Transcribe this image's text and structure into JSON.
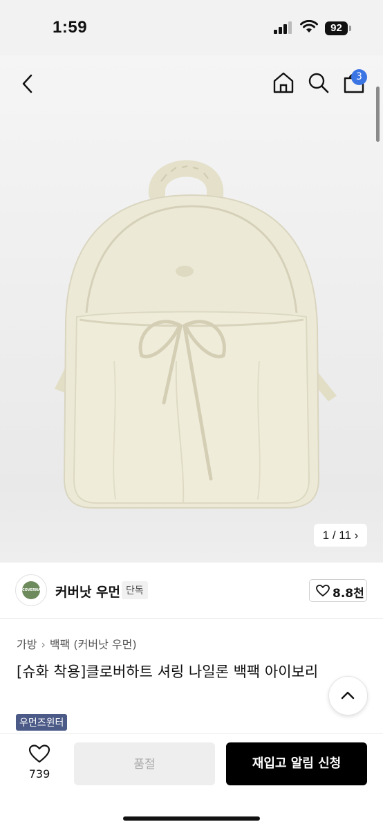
{
  "status_bar": {
    "time": "1:59",
    "battery": "92"
  },
  "header": {
    "icons": [
      "chevron-left-icon",
      "home-icon",
      "search-icon",
      "bag-icon"
    ],
    "cart_count": "3"
  },
  "gallery": {
    "counter": "1 / 11",
    "counter_icon": "chevron-right-icon"
  },
  "brand": {
    "name": "커버낫 우먼",
    "badge": "단독",
    "logo_text": "COVERNAT",
    "likes": "8.8천"
  },
  "breadcrumb": [
    "가방",
    "백팩 (커버낫 우먼)"
  ],
  "product": {
    "title": "[슈화 착용]클로버하트 셔링 나일론 백팩 아이보리",
    "tag": "우먼즈윈터"
  },
  "bottom_bar": {
    "wish_count": "739",
    "soldout_label": "품절",
    "restock_label": "재입고 알림 신청"
  },
  "colors": {
    "accent": "#3b74e3",
    "tag_bg": "#4b5a87",
    "bag": "#ece9d6"
  }
}
